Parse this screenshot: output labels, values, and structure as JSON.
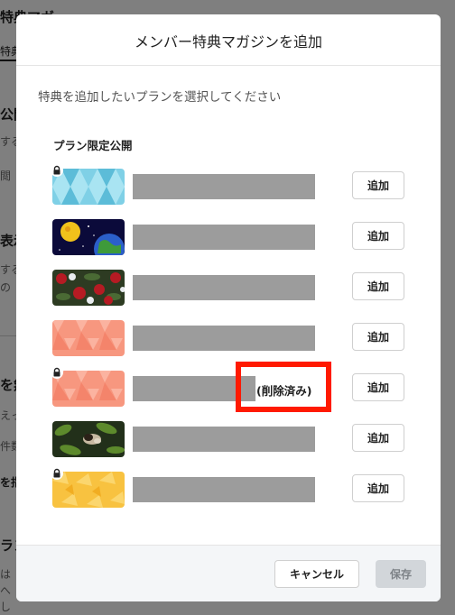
{
  "background": {
    "fragments": [
      "特典マガ",
      "特典",
      "公開",
      "する",
      "閲",
      "表示",
      "する",
      "の",
      "を無",
      "えっ",
      "件数",
      "を指",
      "ラン",
      "は",
      "へ",
      "し"
    ]
  },
  "modal": {
    "title": "メンバー特典マガジンを追加",
    "instruction": "特典を追加したいプランを選択してください",
    "section_label": "プラン限定公開",
    "plans": [
      {
        "add_label": "追加",
        "locked": true,
        "deleted_label": "",
        "thumb": "blue-pattern"
      },
      {
        "add_label": "追加",
        "locked": false,
        "deleted_label": "",
        "thumb": "space-earth"
      },
      {
        "add_label": "追加",
        "locked": false,
        "deleted_label": "",
        "thumb": "roses"
      },
      {
        "add_label": "追加",
        "locked": false,
        "deleted_label": "",
        "thumb": "salmon-pattern"
      },
      {
        "add_label": "追加",
        "locked": true,
        "deleted_label": "(削除済み)",
        "thumb": "salmon-pattern"
      },
      {
        "add_label": "追加",
        "locked": false,
        "deleted_label": "",
        "thumb": "butterfly"
      },
      {
        "add_label": "追加",
        "locked": true,
        "deleted_label": "",
        "thumb": "yellow-pattern"
      }
    ],
    "footer": {
      "cancel_label": "キャンセル",
      "save_label": "保存"
    }
  },
  "colors": {
    "highlight": "#ff1a00",
    "overlay": "rgba(0,0,0,0.5)",
    "save_disabled": "#d2d6da"
  }
}
